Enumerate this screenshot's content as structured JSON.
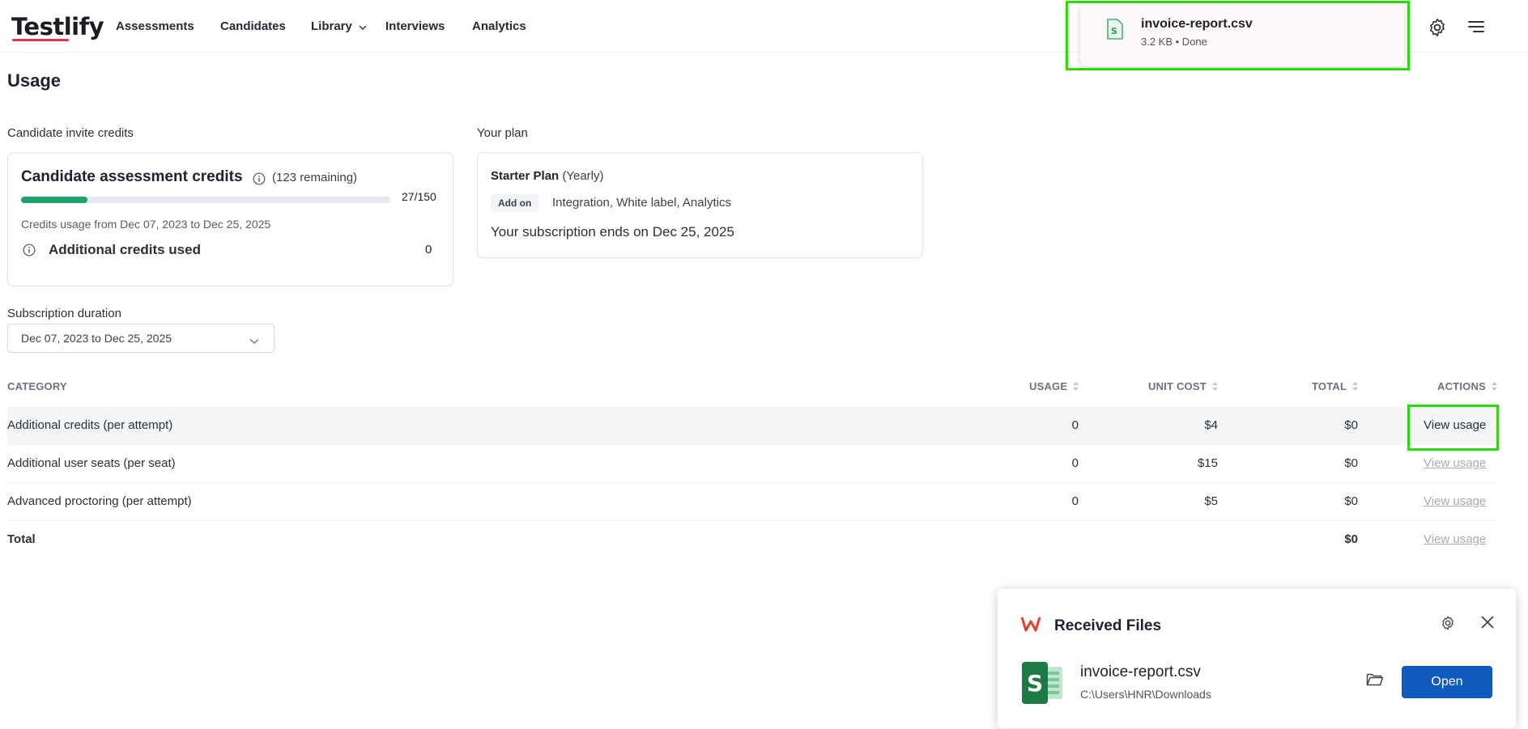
{
  "brand": {
    "name": "Testlify",
    "accent": "#e1344a"
  },
  "nav": {
    "items": [
      "Assessments",
      "Candidates",
      "Library",
      "Interviews",
      "Analytics"
    ],
    "icons": [
      "settings-icon",
      "menu-icon"
    ]
  },
  "download": {
    "filename": "invoice-report.csv",
    "meta": "3.2 KB • Done",
    "icon": "csv-file-icon"
  },
  "page": {
    "title": "Usage"
  },
  "credits": {
    "section_label": "Candidate invite credits",
    "title": "Candidate assessment credits",
    "remaining": "(123 remaining)",
    "used": 27,
    "total": 150,
    "progress_text": "27/150",
    "range_text": "Credits usage from Dec 07, 2023 to Dec 25, 2025",
    "additional_label": "Additional credits used",
    "additional_value": "0",
    "progress_color": "#22a06b"
  },
  "plan": {
    "section_label": "Your plan",
    "name": "Starter Plan",
    "period": "(Yearly)",
    "addon_label": "Add on",
    "addons": "Integration, White label, Analytics",
    "ends_text": "Your subscription ends on Dec 25, 2025"
  },
  "subscription": {
    "label": "Subscription duration",
    "selected": "Dec 07, 2023 to Dec 25, 2025"
  },
  "table": {
    "headers": {
      "category": "CATEGORY",
      "usage": "USAGE",
      "unit_cost": "UNIT COST",
      "total": "TOTAL",
      "actions": "ACTIONS"
    },
    "rows": [
      {
        "category": "Additional credits (per attempt)",
        "usage": "0",
        "unit_cost": "$4",
        "total": "$0",
        "action": "View usage"
      },
      {
        "category": "Additional user seats (per seat)",
        "usage": "0",
        "unit_cost": "$15",
        "total": "$0",
        "action": "View usage"
      },
      {
        "category": "Advanced proctoring (per attempt)",
        "usage": "0",
        "unit_cost": "$5",
        "total": "$0",
        "action": "View usage"
      }
    ],
    "total_row": {
      "label": "Total",
      "total": "$0",
      "action": "View usage"
    }
  },
  "received_files": {
    "title": "Received Files",
    "filename": "invoice-report.csv",
    "path": "C:\\Users\\HNR\\Downloads",
    "open_label": "Open"
  },
  "colors": {
    "highlight": "#2fd80d",
    "open_button": "#0f5bbd"
  }
}
